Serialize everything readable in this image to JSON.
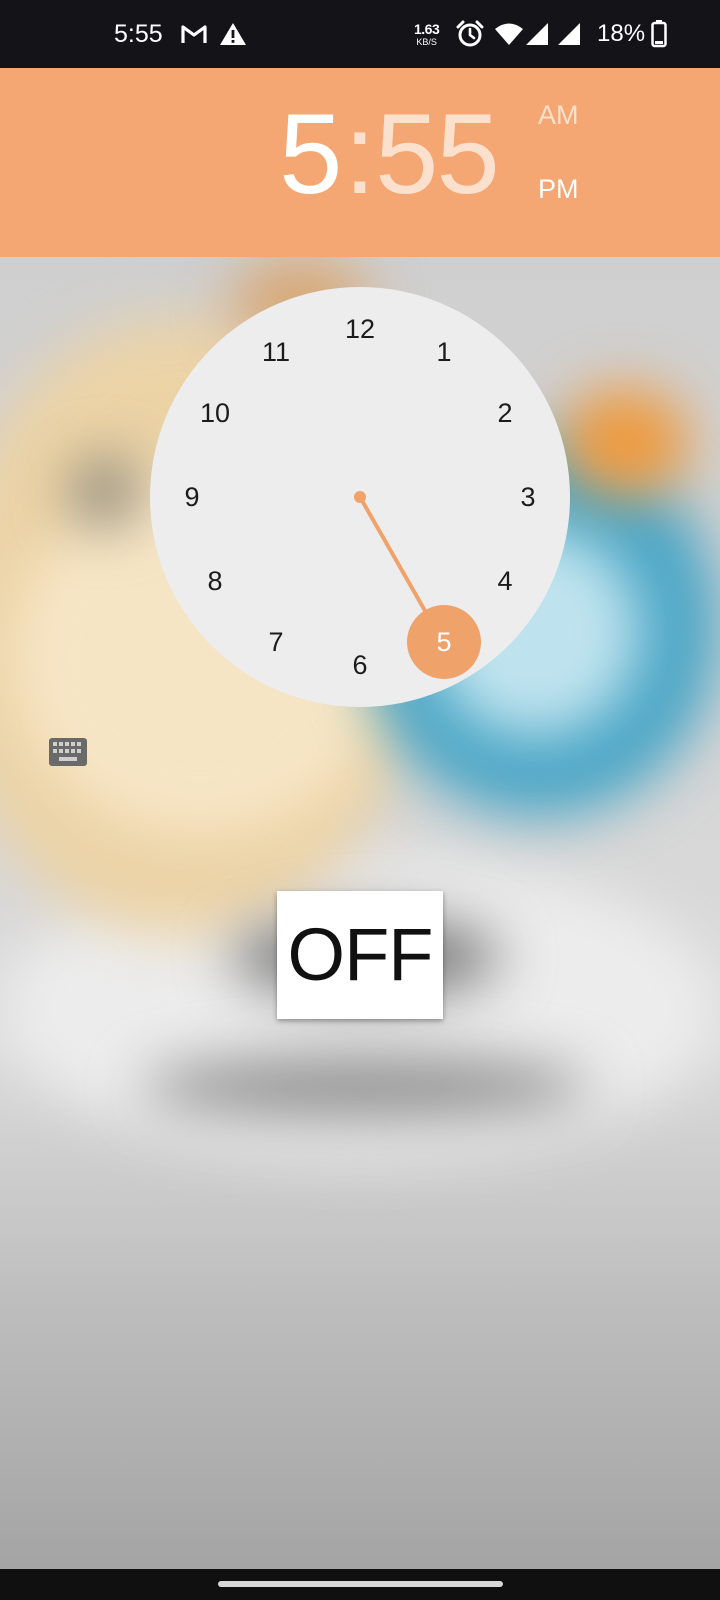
{
  "status_bar": {
    "time": "5:55",
    "net_speed_value": "1.63",
    "net_speed_unit": "KB/S",
    "battery_percent": "18%",
    "icons": [
      "gmail-icon",
      "warning-icon",
      "alarm-icon",
      "wifi-icon",
      "signal-icon",
      "signal-icon",
      "battery-icon"
    ]
  },
  "time_picker": {
    "hour": "5",
    "separator": ":",
    "minute": "55",
    "am_label": "AM",
    "pm_label": "PM",
    "selected_period": "PM",
    "dial_numbers": [
      "12",
      "1",
      "2",
      "3",
      "4",
      "5",
      "6",
      "7",
      "8",
      "9",
      "10",
      "11"
    ],
    "selected_number": "5",
    "keyboard_toggle_icon": "keyboard-icon"
  },
  "off_button": {
    "label": "OFF"
  },
  "colors": {
    "accent": "#f4a772",
    "header_active_text": "#ffffff",
    "header_inactive_text": "#fbe1cd",
    "dial_background": "#ededed",
    "status_bar": "#141318"
  }
}
